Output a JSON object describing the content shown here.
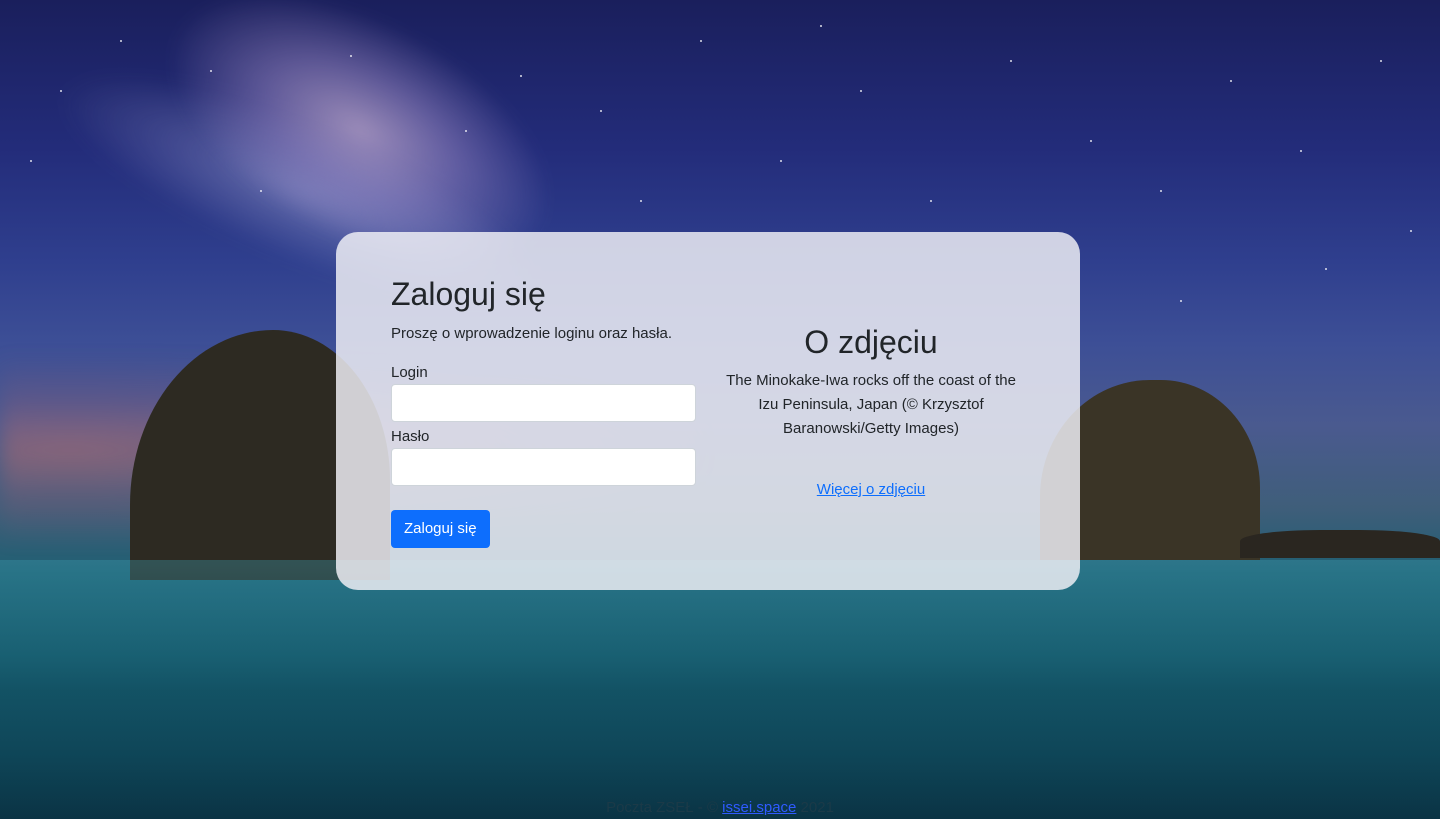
{
  "login": {
    "title": "Zaloguj się",
    "subtitle": "Proszę o wprowadzenie loginu oraz hasła.",
    "login_label": "Login",
    "login_value": "",
    "password_label": "Hasło",
    "password_value": "",
    "submit_label": "Zaloguj się"
  },
  "about": {
    "title": "O zdjęciu",
    "description": "The Minokake-Iwa rocks off the coast of the Izu Peninsula, Japan (© Krzysztof Baranowski/Getty Images)",
    "more_link": "Więcej o zdjęciu"
  },
  "footer": {
    "prefix": "Poczta ZSEŁ - ©",
    "link": "issei.space",
    "year": "2021"
  },
  "colors": {
    "primary": "#0d6efd",
    "card_bg": "#f0f0f5",
    "text": "#212529"
  }
}
